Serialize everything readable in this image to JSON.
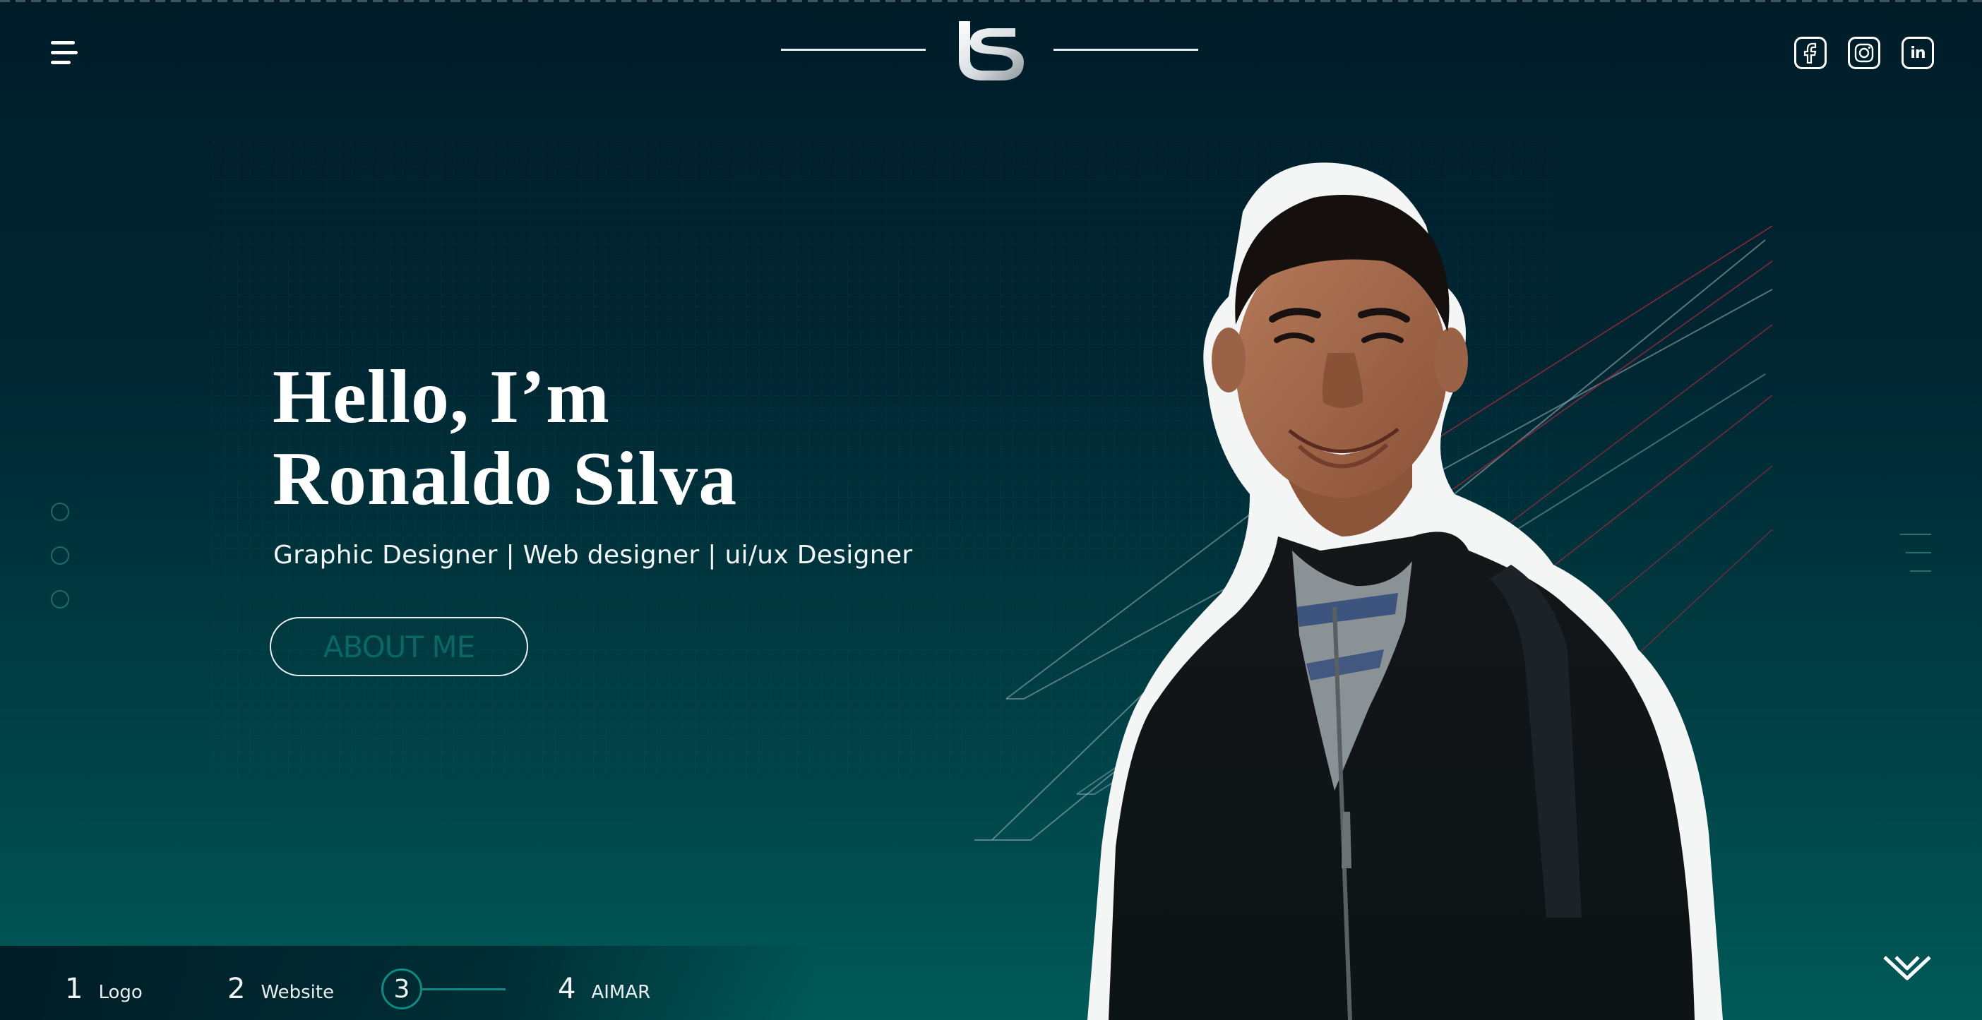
{
  "header": {
    "logo_text": "LS",
    "menu_icon": "hamburger-menu-icon",
    "socials": [
      {
        "name": "facebook",
        "icon": "facebook-icon"
      },
      {
        "name": "instagram",
        "icon": "instagram-icon"
      },
      {
        "name": "linkedin",
        "icon": "linkedin-icon",
        "glyph": "in"
      }
    ]
  },
  "hero": {
    "title_line1": "Hello, I’m",
    "title_line2": "Ronaldo Silva",
    "subtitle": "Graphic Designer | Web designer | ui/ux Designer",
    "cta_label": "ABOUT ME"
  },
  "side_dots": {
    "count": 3
  },
  "bottom_nav": {
    "items": [
      {
        "num": "1",
        "label": "Logo"
      },
      {
        "num": "2",
        "label": "Website"
      },
      {
        "num": "3",
        "label": "",
        "active": true
      },
      {
        "num": "4",
        "label": "AIMAR"
      }
    ]
  },
  "colors": {
    "bg_top": "#001c29",
    "bg_bottom": "#005a58",
    "accent": "#0e8a86",
    "cta_text": "#0b6664",
    "stripe_red": "#8a2b3a",
    "stripe_light": "#8fa7ad"
  },
  "icons": {
    "scroll_down": "double-chevron-down-icon"
  }
}
